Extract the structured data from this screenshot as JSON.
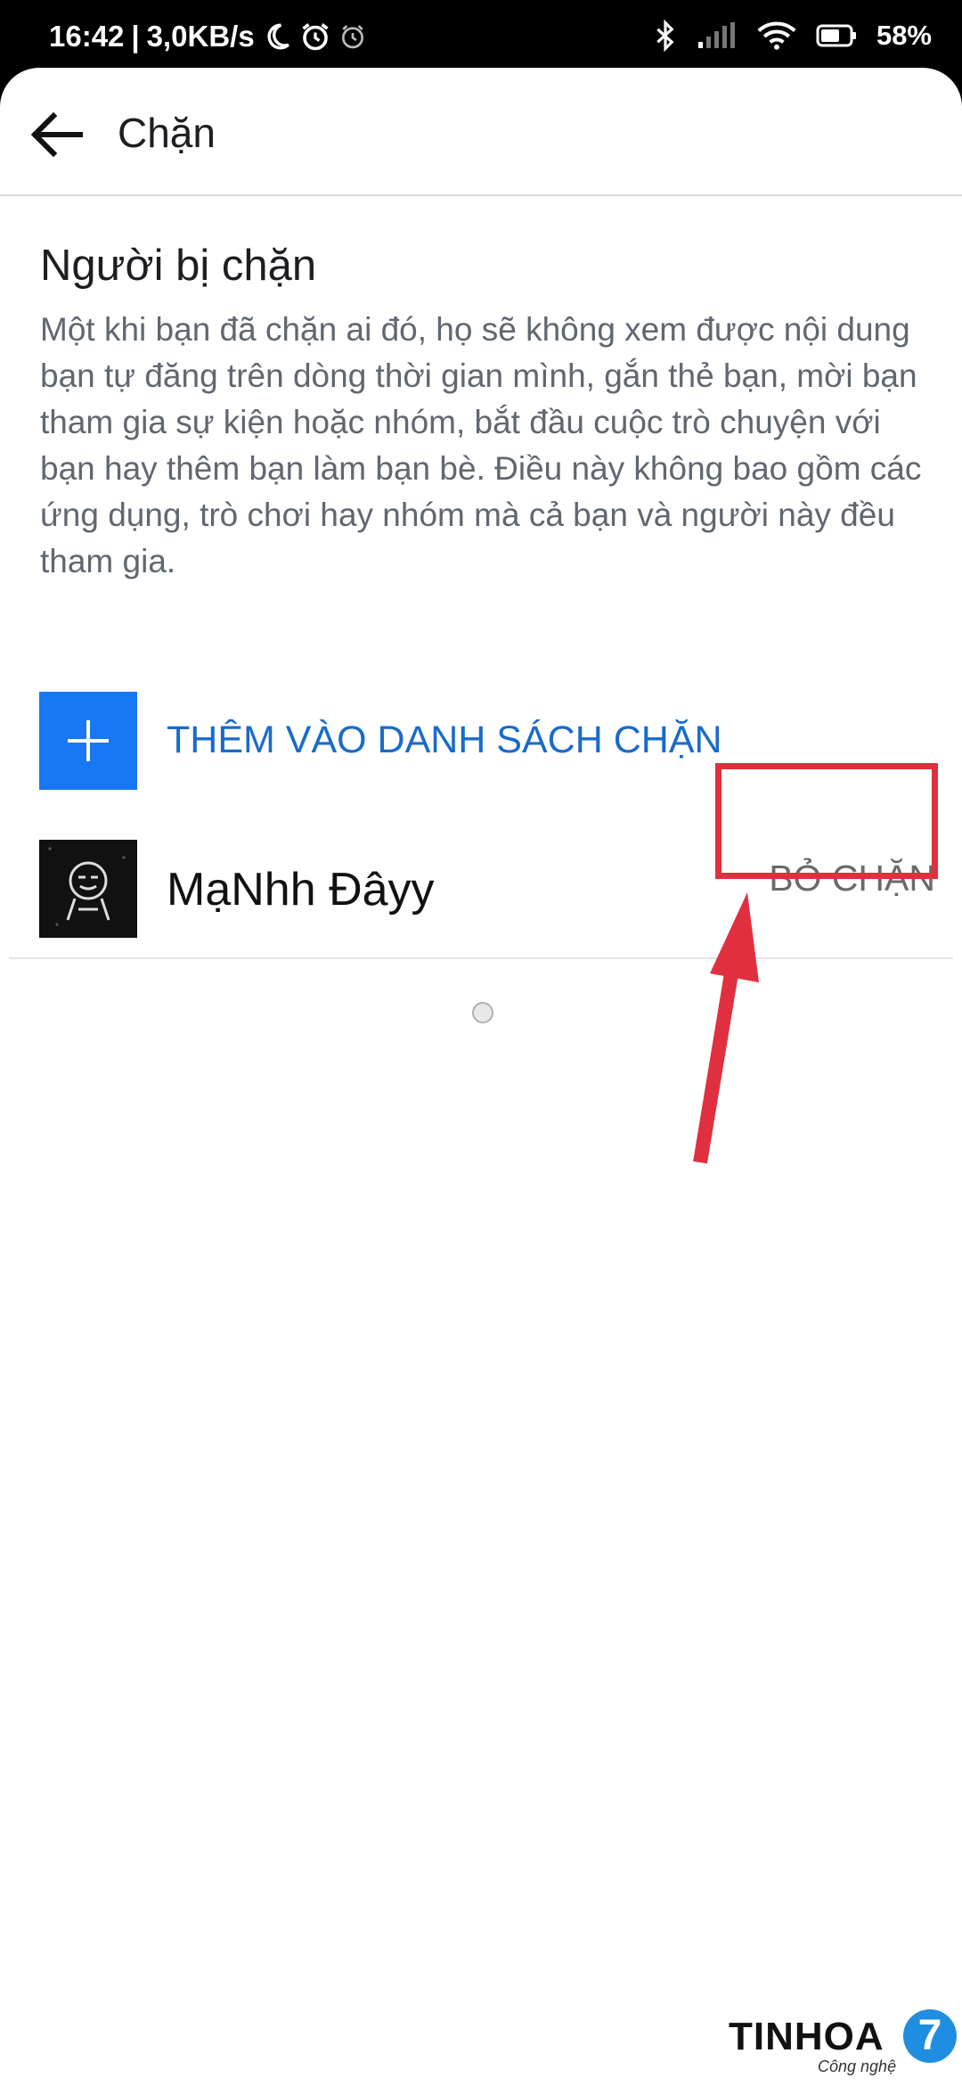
{
  "status_bar": {
    "time": "16:42",
    "separator": "|",
    "speed": "3,0KB/s",
    "battery": "58%",
    "icons": [
      "moon-icon",
      "alarm-icon",
      "clock-icon",
      "bluetooth-icon",
      "signal-icon",
      "wifi-icon",
      "battery-icon"
    ]
  },
  "app_bar": {
    "title": "Chặn",
    "back_icon": "arrow-left-icon"
  },
  "section": {
    "title": "Người bị chặn",
    "description": "Một khi bạn đã chặn ai đó, họ sẽ không xem được nội dung bạn tự đăng trên dòng thời gian mình, gắn thẻ bạn, mời bạn tham gia sự kiện hoặc nhóm, bắt đầu cuộc trò chuyện với bạn hay thêm bạn làm bạn bè. Điều này không bao gồm các ứng dụng, trò chơi hay nhóm mà cả bạn và người này đều tham gia."
  },
  "add_to_blocklist": {
    "label": "THÊM VÀO DANH SÁCH CHẶN",
    "icon": "plus-icon"
  },
  "blocked_users": [
    {
      "name": "MạNhh Đâyy",
      "action_label": "BỎ CHẶN"
    }
  ],
  "annotation": {
    "color": "#e0303f"
  },
  "watermark": {
    "brand": "TINHOA",
    "tagline": "Công nghệ",
    "badge": "7"
  },
  "colors": {
    "accent": "#1877f2",
    "link": "#1a6bc9"
  }
}
